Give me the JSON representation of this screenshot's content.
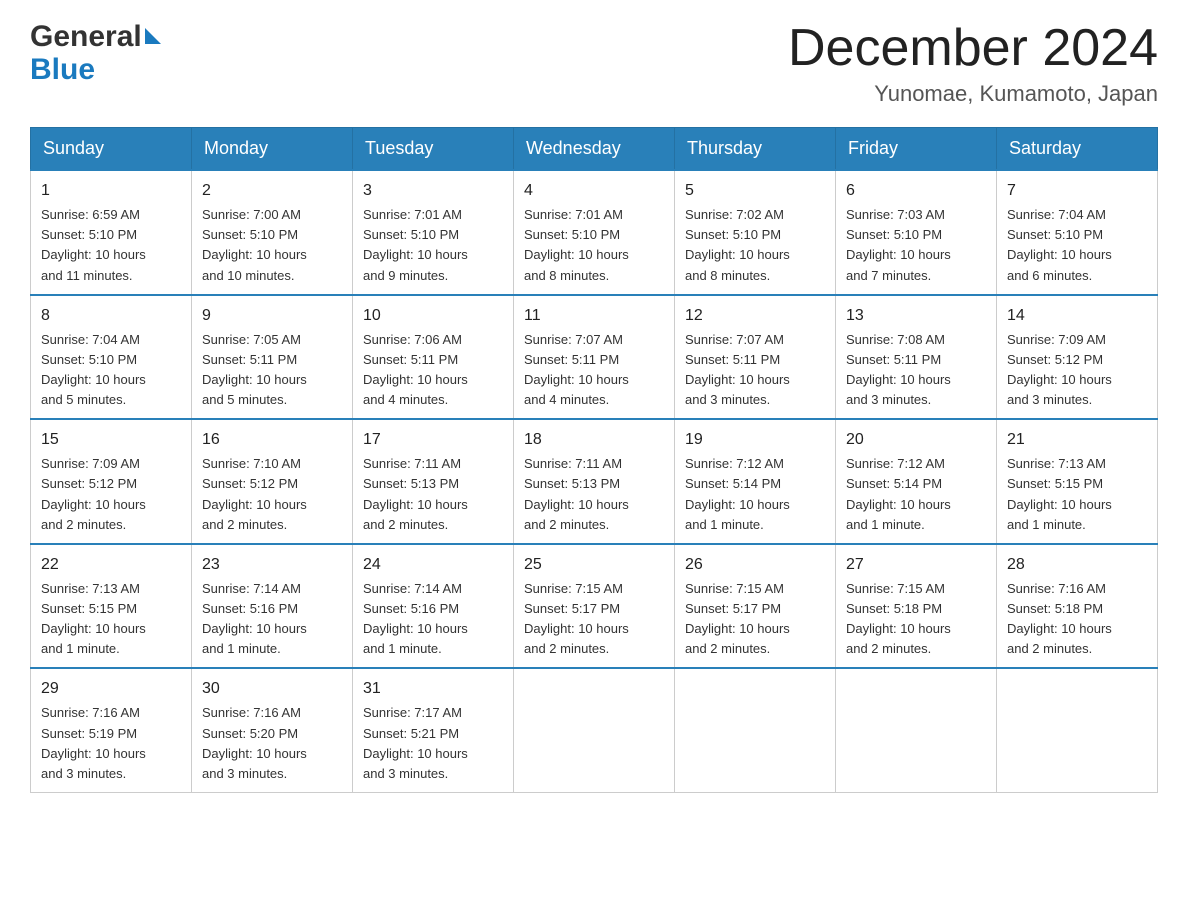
{
  "logo": {
    "general": "General",
    "blue": "Blue"
  },
  "title": {
    "month": "December 2024",
    "location": "Yunomae, Kumamoto, Japan"
  },
  "headers": [
    "Sunday",
    "Monday",
    "Tuesday",
    "Wednesday",
    "Thursday",
    "Friday",
    "Saturday"
  ],
  "weeks": [
    [
      {
        "day": "1",
        "info": "Sunrise: 6:59 AM\nSunset: 5:10 PM\nDaylight: 10 hours\nand 11 minutes."
      },
      {
        "day": "2",
        "info": "Sunrise: 7:00 AM\nSunset: 5:10 PM\nDaylight: 10 hours\nand 10 minutes."
      },
      {
        "day": "3",
        "info": "Sunrise: 7:01 AM\nSunset: 5:10 PM\nDaylight: 10 hours\nand 9 minutes."
      },
      {
        "day": "4",
        "info": "Sunrise: 7:01 AM\nSunset: 5:10 PM\nDaylight: 10 hours\nand 8 minutes."
      },
      {
        "day": "5",
        "info": "Sunrise: 7:02 AM\nSunset: 5:10 PM\nDaylight: 10 hours\nand 8 minutes."
      },
      {
        "day": "6",
        "info": "Sunrise: 7:03 AM\nSunset: 5:10 PM\nDaylight: 10 hours\nand 7 minutes."
      },
      {
        "day": "7",
        "info": "Sunrise: 7:04 AM\nSunset: 5:10 PM\nDaylight: 10 hours\nand 6 minutes."
      }
    ],
    [
      {
        "day": "8",
        "info": "Sunrise: 7:04 AM\nSunset: 5:10 PM\nDaylight: 10 hours\nand 5 minutes."
      },
      {
        "day": "9",
        "info": "Sunrise: 7:05 AM\nSunset: 5:11 PM\nDaylight: 10 hours\nand 5 minutes."
      },
      {
        "day": "10",
        "info": "Sunrise: 7:06 AM\nSunset: 5:11 PM\nDaylight: 10 hours\nand 4 minutes."
      },
      {
        "day": "11",
        "info": "Sunrise: 7:07 AM\nSunset: 5:11 PM\nDaylight: 10 hours\nand 4 minutes."
      },
      {
        "day": "12",
        "info": "Sunrise: 7:07 AM\nSunset: 5:11 PM\nDaylight: 10 hours\nand 3 minutes."
      },
      {
        "day": "13",
        "info": "Sunrise: 7:08 AM\nSunset: 5:11 PM\nDaylight: 10 hours\nand 3 minutes."
      },
      {
        "day": "14",
        "info": "Sunrise: 7:09 AM\nSunset: 5:12 PM\nDaylight: 10 hours\nand 3 minutes."
      }
    ],
    [
      {
        "day": "15",
        "info": "Sunrise: 7:09 AM\nSunset: 5:12 PM\nDaylight: 10 hours\nand 2 minutes."
      },
      {
        "day": "16",
        "info": "Sunrise: 7:10 AM\nSunset: 5:12 PM\nDaylight: 10 hours\nand 2 minutes."
      },
      {
        "day": "17",
        "info": "Sunrise: 7:11 AM\nSunset: 5:13 PM\nDaylight: 10 hours\nand 2 minutes."
      },
      {
        "day": "18",
        "info": "Sunrise: 7:11 AM\nSunset: 5:13 PM\nDaylight: 10 hours\nand 2 minutes."
      },
      {
        "day": "19",
        "info": "Sunrise: 7:12 AM\nSunset: 5:14 PM\nDaylight: 10 hours\nand 1 minute."
      },
      {
        "day": "20",
        "info": "Sunrise: 7:12 AM\nSunset: 5:14 PM\nDaylight: 10 hours\nand 1 minute."
      },
      {
        "day": "21",
        "info": "Sunrise: 7:13 AM\nSunset: 5:15 PM\nDaylight: 10 hours\nand 1 minute."
      }
    ],
    [
      {
        "day": "22",
        "info": "Sunrise: 7:13 AM\nSunset: 5:15 PM\nDaylight: 10 hours\nand 1 minute."
      },
      {
        "day": "23",
        "info": "Sunrise: 7:14 AM\nSunset: 5:16 PM\nDaylight: 10 hours\nand 1 minute."
      },
      {
        "day": "24",
        "info": "Sunrise: 7:14 AM\nSunset: 5:16 PM\nDaylight: 10 hours\nand 1 minute."
      },
      {
        "day": "25",
        "info": "Sunrise: 7:15 AM\nSunset: 5:17 PM\nDaylight: 10 hours\nand 2 minutes."
      },
      {
        "day": "26",
        "info": "Sunrise: 7:15 AM\nSunset: 5:17 PM\nDaylight: 10 hours\nand 2 minutes."
      },
      {
        "day": "27",
        "info": "Sunrise: 7:15 AM\nSunset: 5:18 PM\nDaylight: 10 hours\nand 2 minutes."
      },
      {
        "day": "28",
        "info": "Sunrise: 7:16 AM\nSunset: 5:18 PM\nDaylight: 10 hours\nand 2 minutes."
      }
    ],
    [
      {
        "day": "29",
        "info": "Sunrise: 7:16 AM\nSunset: 5:19 PM\nDaylight: 10 hours\nand 3 minutes."
      },
      {
        "day": "30",
        "info": "Sunrise: 7:16 AM\nSunset: 5:20 PM\nDaylight: 10 hours\nand 3 minutes."
      },
      {
        "day": "31",
        "info": "Sunrise: 7:17 AM\nSunset: 5:21 PM\nDaylight: 10 hours\nand 3 minutes."
      },
      {
        "day": "",
        "info": ""
      },
      {
        "day": "",
        "info": ""
      },
      {
        "day": "",
        "info": ""
      },
      {
        "day": "",
        "info": ""
      }
    ]
  ]
}
